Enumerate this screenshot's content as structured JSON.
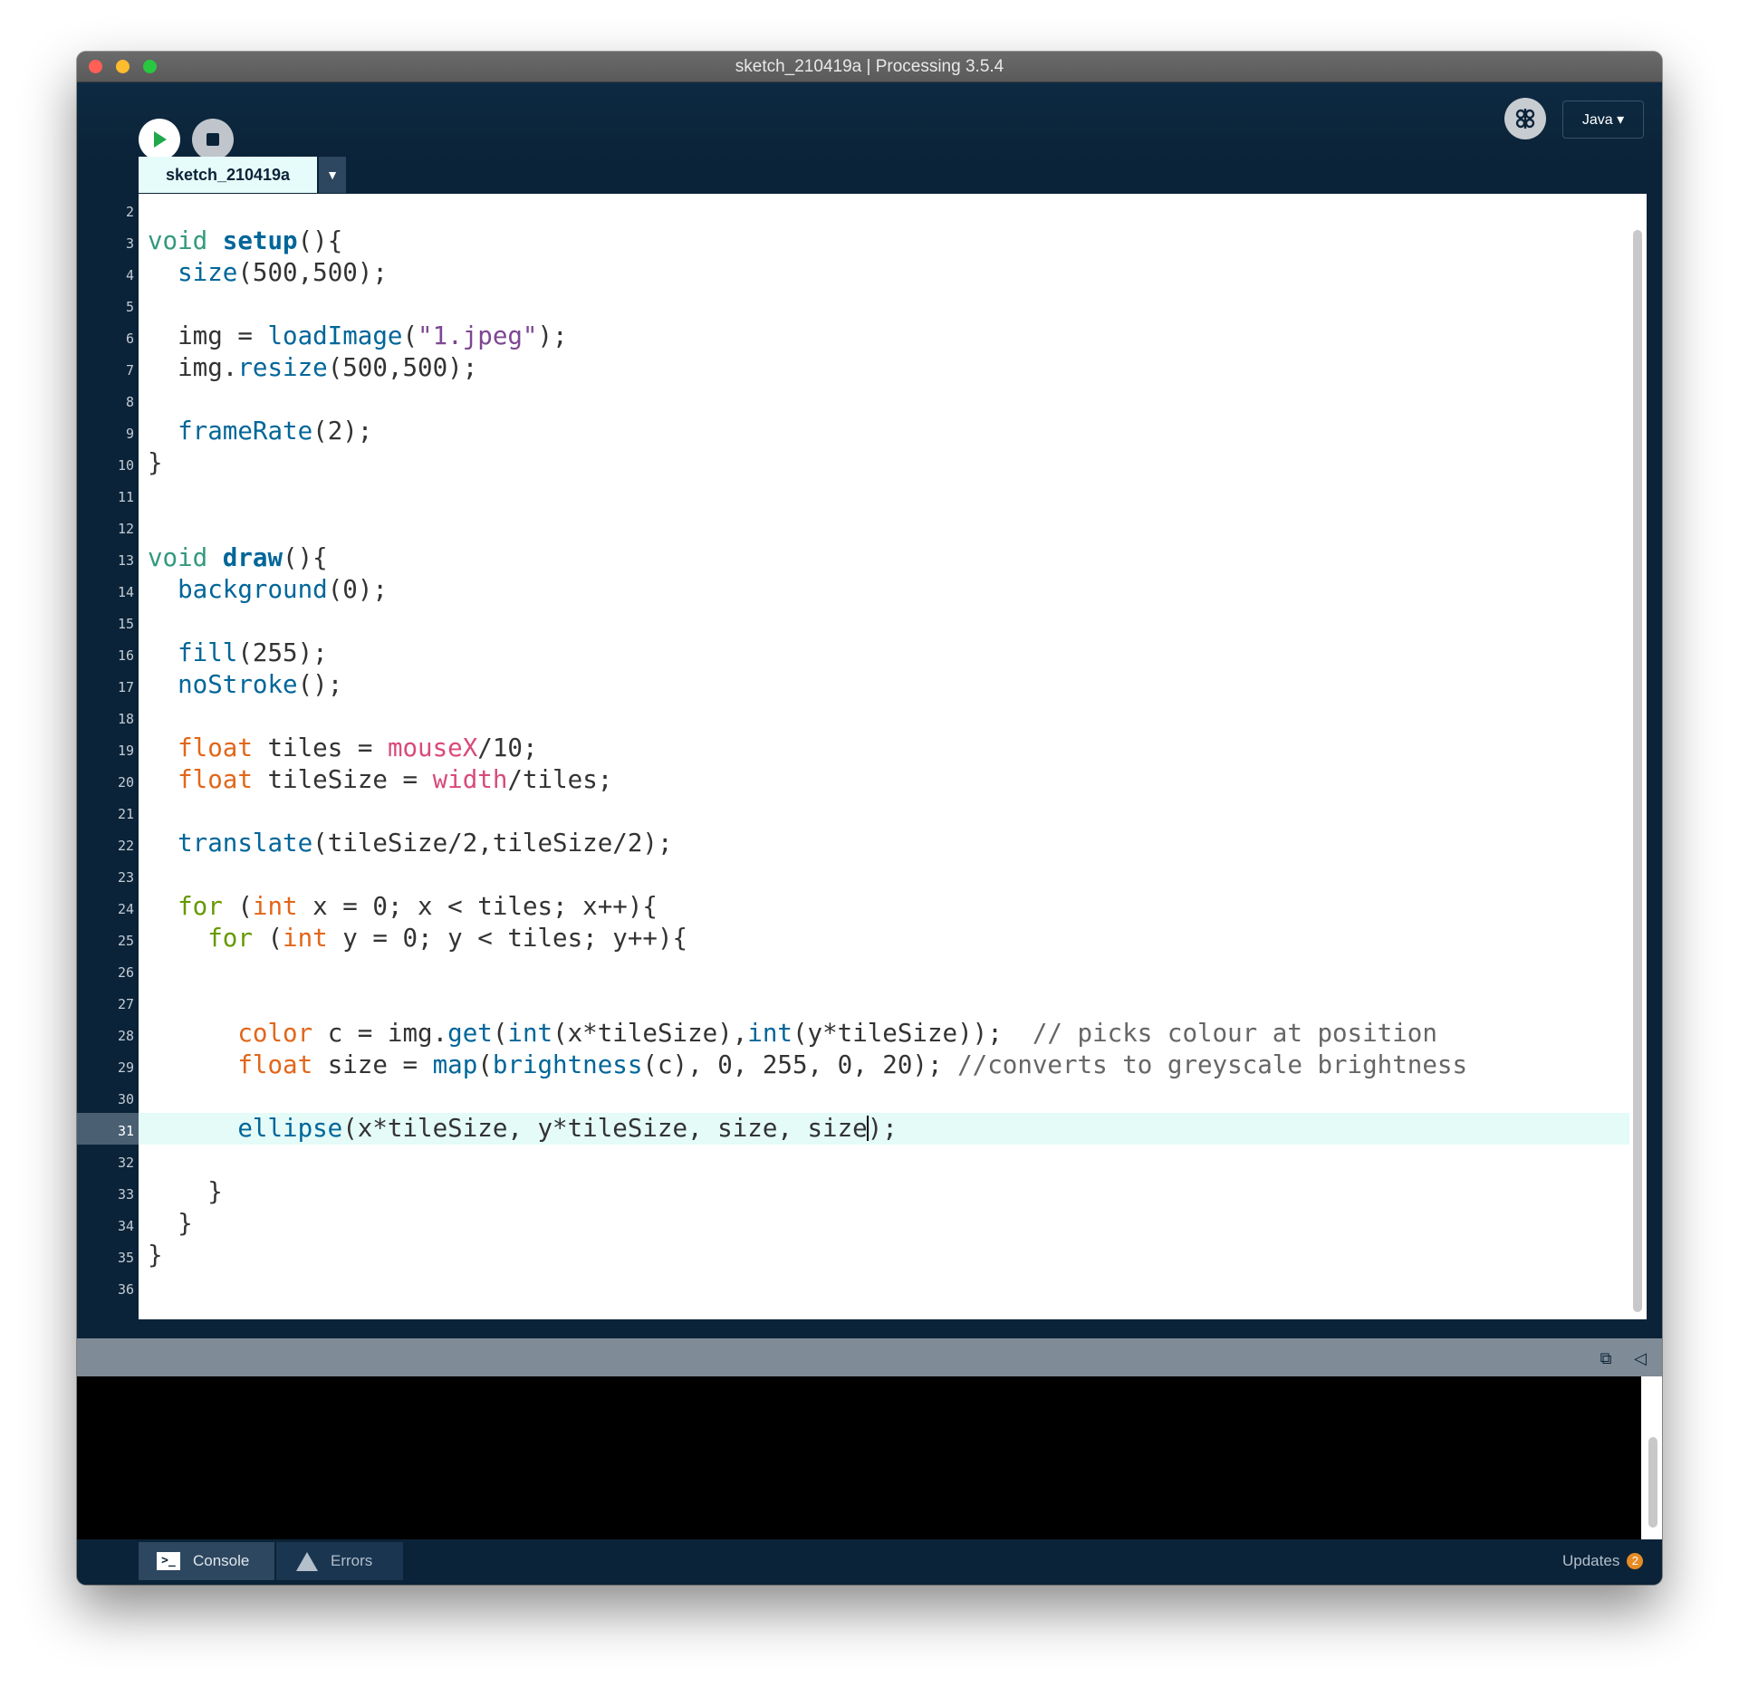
{
  "window": {
    "title": "sketch_210419a | Processing 3.5.4"
  },
  "toolbar": {
    "run_icon": "play-icon",
    "stop_icon": "stop-icon",
    "debug_icon": "debug-butterfly-icon",
    "mode": "Java ▾"
  },
  "tabs": [
    {
      "label": "sketch_210419a"
    }
  ],
  "editor": {
    "current_line": 31,
    "line_numbers": [
      "2",
      "3",
      "4",
      "5",
      "6",
      "7",
      "8",
      "9",
      "10",
      "11",
      "12",
      "13",
      "14",
      "15",
      "16",
      "17",
      "18",
      "19",
      "20",
      "21",
      "22",
      "23",
      "24",
      "25",
      "26",
      "27",
      "28",
      "29",
      "30",
      "31",
      "32",
      "33",
      "34",
      "35",
      "36"
    ],
    "tokens": {
      "void": "void",
      "setup": "setup",
      "draw": "draw",
      "size_fn": "size",
      "loadImage": "loadImage",
      "resize": "resize",
      "frameRate": "frameRate",
      "background": "background",
      "fill": "fill",
      "noStroke": "noStroke",
      "float": "float",
      "mouseX": "mouseX",
      "width": "width",
      "translate": "translate",
      "for": "for",
      "int": "int",
      "color": "color",
      "get": "get",
      "map": "map",
      "brightness": "brightness",
      "ellipse": "ellipse",
      "str_jpeg": "\"1.jpeg\"",
      "comment_28": "// picks colour at position",
      "comment_29": "//converts to greyscale brightness"
    }
  },
  "console": {
    "tabs": [
      {
        "label": "Console",
        "icon": "console-icon"
      },
      {
        "label": "Errors",
        "icon": "warning-icon"
      }
    ],
    "updates_label": "Updates",
    "updates_count": "2"
  },
  "colors": {
    "background_dark": "#0b2338",
    "keyword": "#33997e",
    "function": "#006699",
    "type": "#e2661a",
    "control": "#669900",
    "string": "#7d4793",
    "builtin_var": "#d94a7a",
    "comment": "#666666",
    "current_line": "#e4fbf8"
  }
}
